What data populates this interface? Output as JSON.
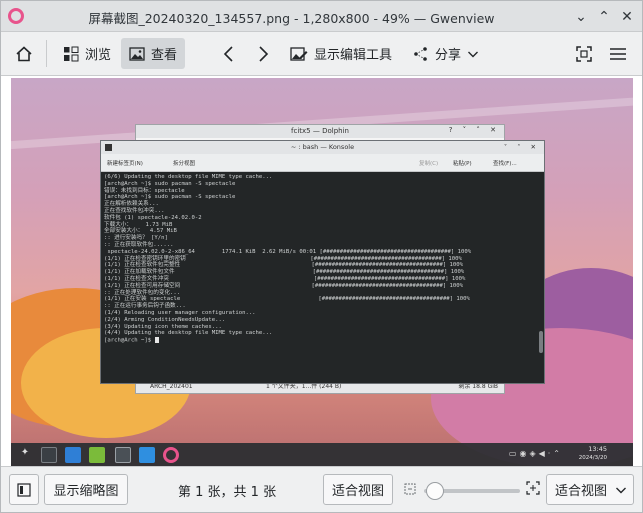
{
  "window": {
    "title": "屏幕截图_20240320_134557.png - 1,280x800 - 49% — Gwenview",
    "btn_minimize": "⌄",
    "btn_maximize": "⌃",
    "btn_close": "✕"
  },
  "toolbar": {
    "browse_label": "浏览",
    "view_label": "查看",
    "show_editing_tools_label": "显示编辑工具",
    "share_label": "分享"
  },
  "screenshot": {
    "dolphin": {
      "title": "fcitx5 — Dolphin",
      "status_left": "ARCH_202401",
      "status_mid": "1 个文件夹，1...件 (244 B)",
      "status_right": "剩余 18.8 GiB"
    },
    "konsole": {
      "title": "~ : bash — Konsole",
      "new_tab": "新建标签页(N)",
      "split_view": "拆分视图",
      "copy": "复制(C)",
      "paste": "粘贴(P)",
      "find": "查找(F)...",
      "lines": [
        "(6/6) Updating the desktop file MIME type cache...",
        "[arch@Arch ~]$ sudo pacman -S spectacle",
        "错误：未找到目标：spectacle",
        "[arch@Arch ~]$ sudo pacman -S spectacle",
        "正在解析依赖关系...",
        "正在查找软件包冲突...",
        "",
        "软件包 (1) spectacle-24.02.0-2",
        "",
        "下载大小：    1.73 MiB",
        "全部安装大小：  4.57 MiB",
        "",
        ":: 进行安装吗？ [Y/n]",
        ":: 正在获取软件包......",
        " spectacle-24.02.0-2-x86_64        1774.1 KiB  2.62 MiB/s 00:01 [######################################] 100%",
        "(1/1) 正在检查密钥环里的密钥                                     [######################################] 100%",
        "(1/1) 正在检查软件包完整性                                       [######################################] 100%",
        "(1/1) 正在加载软件包文件                                         [######################################] 100%",
        "(1/1) 正在检查文件冲突                                           [######################################] 100%",
        "(1/1) 正在检查可用存储空间                                       [######################################] 100%",
        ":: 正在处理软件包的变化...",
        "(1/1) 正在安装 spectacle                                         [######################################] 100%",
        ":: 正在运行事务后钩子函数...",
        "(1/4) Reloading user manager configuration...",
        "(2/4) Arming ConditionNeedsUpdate...",
        "(3/4) Updating icon theme caches...",
        "(4/4) Updating the desktop file MIME type cache...",
        "[arch@Arch ~]$ "
      ]
    },
    "taskbar": {
      "time": "13:45",
      "date": "2024/3/20"
    }
  },
  "bottombar": {
    "show_thumbnails_label": "显示缩略图",
    "page_info": "第 1 张，共 1 张",
    "fit_view_button": "适合视图",
    "zoom_select_value": "适合视图"
  },
  "colors": {
    "accent": "#e8548c",
    "terminal_bg": "#232627"
  }
}
